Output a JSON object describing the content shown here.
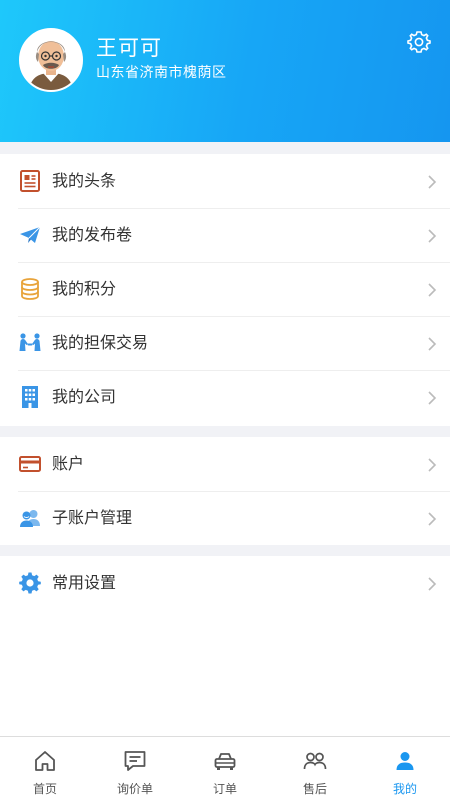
{
  "profile": {
    "name": "王可可",
    "location": "山东省济南市槐荫区"
  },
  "menu_group_1": [
    {
      "label": "我的头条",
      "icon": "newspaper-icon",
      "icon_color": "#c2502d"
    },
    {
      "label": "我的发布卷",
      "icon": "paper-plane-icon",
      "icon_color": "#3a95e6"
    },
    {
      "label": "我的积分",
      "icon": "database-coins-icon",
      "icon_color": "#e8a33a"
    },
    {
      "label": "我的担保交易",
      "icon": "handshake-people-icon",
      "icon_color": "#3a95e6"
    },
    {
      "label": "我的公司",
      "icon": "building-icon",
      "icon_color": "#3a95e6"
    }
  ],
  "menu_group_2": [
    {
      "label": "账户",
      "icon": "card-icon",
      "icon_color": "#c2502d"
    },
    {
      "label": "子账户管理",
      "icon": "users-icon",
      "icon_color": "#3a95e6"
    }
  ],
  "menu_group_3": [
    {
      "label": "常用设置",
      "icon": "gear-icon",
      "icon_color": "#3a95e6"
    }
  ],
  "tabbar": [
    {
      "label": "首页",
      "icon": "home-icon",
      "active": false
    },
    {
      "label": "询价单",
      "icon": "chat-list-icon",
      "active": false
    },
    {
      "label": "订单",
      "icon": "car-icon",
      "active": false
    },
    {
      "label": "售后",
      "icon": "service-people-icon",
      "active": false
    },
    {
      "label": "我的",
      "icon": "person-icon",
      "active": true
    }
  ],
  "colors": {
    "header_gradient_start": "#1ec8fb",
    "header_gradient_end": "#1596f0",
    "accent": "#1a97f0",
    "background": "#f1f2f6"
  }
}
